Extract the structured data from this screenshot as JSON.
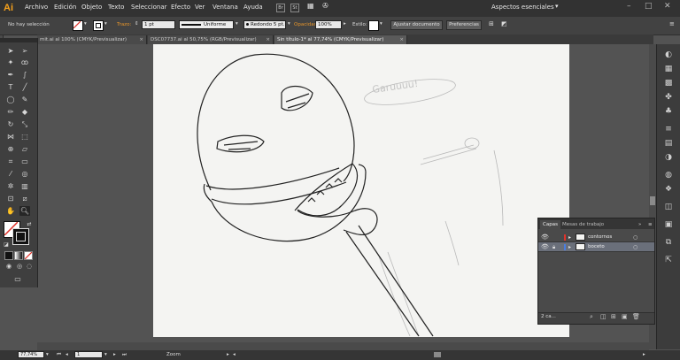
{
  "app": {
    "logo": "Ai",
    "menus": [
      "Archivo",
      "Edición",
      "Objeto",
      "Texto",
      "Seleccionar",
      "Efecto",
      "Ver",
      "Ventana",
      "Ayuda"
    ],
    "menubar_icons": [
      "Br",
      "St"
    ],
    "workspace": "Aspectos esenciales",
    "window_controls": [
      "–",
      "□",
      "✕"
    ]
  },
  "control": {
    "selection": "No hay selección",
    "stroke_label": "Trazo:",
    "stroke_weight": "1 pt",
    "profile": "Uniforme",
    "brush": "Redondo 5 pt.",
    "opacity_label": "Opacidad:",
    "opacity": "100%",
    "style_label": "Estilo:",
    "align_doc": "Ajustar documento",
    "prefs": "Preferencias"
  },
  "tabs": [
    {
      "label": "mit.ai al 100% (CMYK/Previsualizar)",
      "active": false
    },
    {
      "label": "DSC07737.ai al 50,75% (RGB/Previsualizar)",
      "active": false
    },
    {
      "label": "Sin título-1* al 77,74% (CMYK/Previsualizar)",
      "active": true
    }
  ],
  "layers": {
    "tabs": [
      "Capas",
      "Mesas de trabajo"
    ],
    "rows": [
      {
        "name": "contornos",
        "color": "#e0332b",
        "selected": false
      },
      {
        "name": "boceto",
        "color": "#4a7de0",
        "selected": true
      }
    ],
    "count": "2 ca..."
  },
  "artboard": {
    "sketch_word": "Garuuuu!"
  },
  "status": {
    "zoom": "77,74%",
    "page": "1",
    "mode": "Zoom"
  },
  "colors": {
    "accent_orange": "#f7a21b",
    "interface": "#535353"
  }
}
